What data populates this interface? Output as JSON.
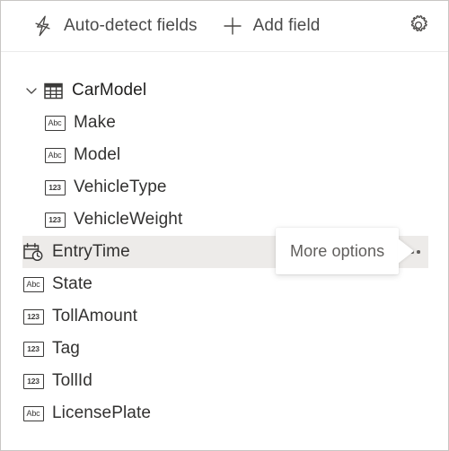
{
  "toolbar": {
    "auto_detect_label": "Auto-detect fields",
    "auto_detect_icon": "lightning-bolt-icon",
    "add_field_label": "Add field",
    "add_field_icon": "plus-icon",
    "settings_icon": "gear-icon"
  },
  "tree": {
    "root": {
      "label": "CarModel",
      "icon": "table-icon",
      "expand_icon": "chevron-down-icon",
      "expanded": true
    },
    "fields": [
      {
        "label": "Make",
        "type": "text",
        "type_icon": "abc-icon",
        "badge": "Abc",
        "indent": 1,
        "selected": false
      },
      {
        "label": "Model",
        "type": "text",
        "type_icon": "abc-icon",
        "badge": "Abc",
        "indent": 1,
        "selected": false
      },
      {
        "label": "VehicleType",
        "type": "number",
        "type_icon": "123-icon",
        "badge": "123",
        "indent": 1,
        "selected": false
      },
      {
        "label": "VehicleWeight",
        "type": "number",
        "type_icon": "123-icon",
        "badge": "123",
        "indent": 1,
        "selected": false
      },
      {
        "label": "EntryTime",
        "type": "datetime",
        "type_icon": "calendar-clock-icon",
        "badge": "",
        "indent": 0,
        "selected": true
      },
      {
        "label": "State",
        "type": "text",
        "type_icon": "abc-icon",
        "badge": "Abc",
        "indent": 0,
        "selected": false
      },
      {
        "label": "TollAmount",
        "type": "number",
        "type_icon": "123-icon",
        "badge": "123",
        "indent": 0,
        "selected": false
      },
      {
        "label": "Tag",
        "type": "number",
        "type_icon": "123-icon",
        "badge": "123",
        "indent": 0,
        "selected": false
      },
      {
        "label": "TollId",
        "type": "number",
        "type_icon": "123-icon",
        "badge": "123",
        "indent": 0,
        "selected": false
      },
      {
        "label": "LicensePlate",
        "type": "text",
        "type_icon": "abc-icon",
        "badge": "Abc",
        "indent": 0,
        "selected": false
      }
    ]
  },
  "more_options": {
    "icon": "ellipsis-icon",
    "tooltip": "More options"
  },
  "colors": {
    "selected_row": "#edebe9",
    "border": "#c8c6c4",
    "text": "#323130",
    "muted_text": "#605e5c",
    "separator": "#ebebeb"
  }
}
